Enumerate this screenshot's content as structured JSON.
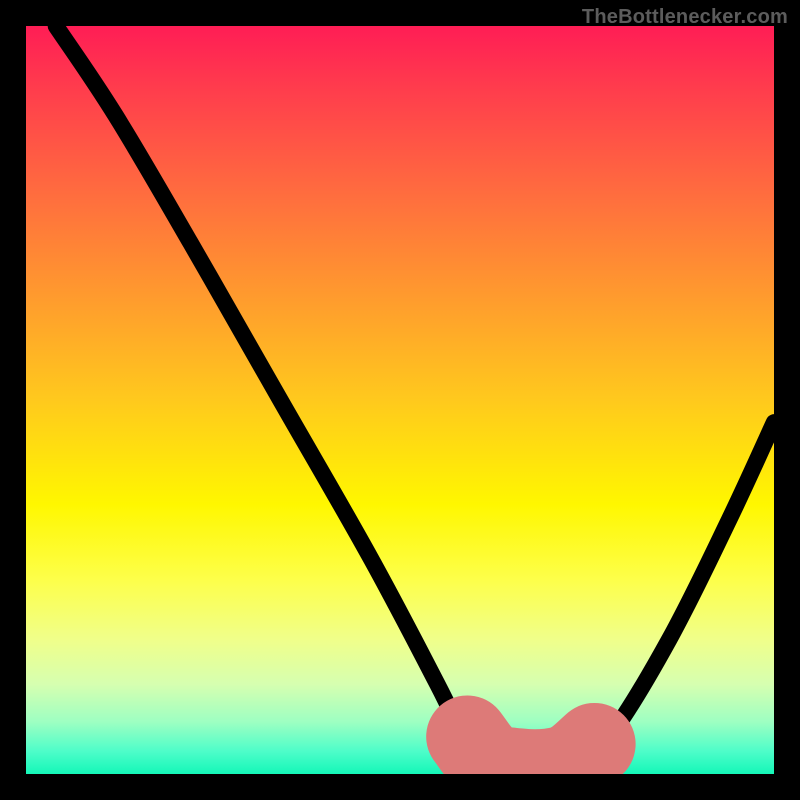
{
  "watermark": "TheBottlenecker.com",
  "chart_data": {
    "type": "line",
    "title": "",
    "xlabel": "",
    "ylabel": "",
    "xlim": [
      0,
      100
    ],
    "ylim": [
      0,
      100
    ],
    "gradient_meaning": "background heat gradient red (top) → green (bottom)",
    "series": [
      {
        "name": "bottleneck-curve",
        "points": [
          {
            "x": 4,
            "y": 100
          },
          {
            "x": 12,
            "y": 88
          },
          {
            "x": 22,
            "y": 71
          },
          {
            "x": 34,
            "y": 50
          },
          {
            "x": 46,
            "y": 29
          },
          {
            "x": 55,
            "y": 12
          },
          {
            "x": 59,
            "y": 4
          },
          {
            "x": 62,
            "y": 1
          },
          {
            "x": 68,
            "y": 0
          },
          {
            "x": 73,
            "y": 1
          },
          {
            "x": 78,
            "y": 5
          },
          {
            "x": 86,
            "y": 18
          },
          {
            "x": 94,
            "y": 34
          },
          {
            "x": 100,
            "y": 47
          }
        ]
      }
    ],
    "highlight": {
      "name": "optimal-range-marker",
      "color": "#dd7a78",
      "points": [
        {
          "x": 59,
          "y": 5
        },
        {
          "x": 62,
          "y": 1.5
        },
        {
          "x": 66,
          "y": 0.6
        },
        {
          "x": 70,
          "y": 0.6
        },
        {
          "x": 73,
          "y": 1.5
        },
        {
          "x": 76,
          "y": 4
        }
      ],
      "lead_dot": {
        "x": 57.5,
        "y": 7.5
      }
    }
  }
}
